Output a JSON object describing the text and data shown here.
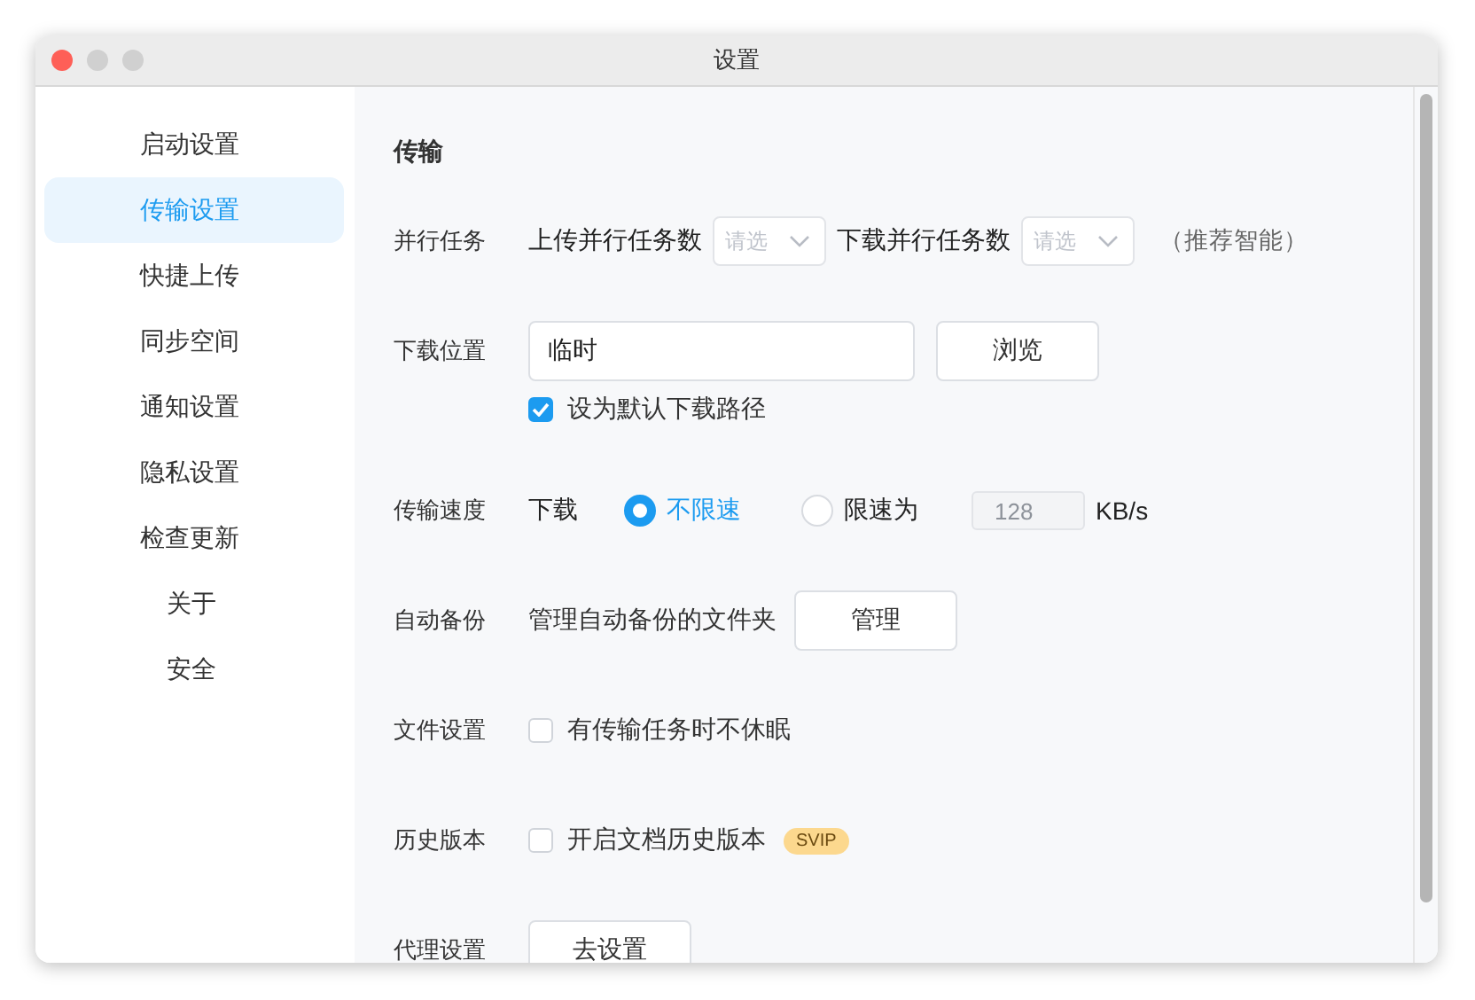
{
  "window": {
    "title": "设置"
  },
  "sidebar": {
    "items": [
      {
        "label": "启动设置",
        "selected": false
      },
      {
        "label": "传输设置",
        "selected": true
      },
      {
        "label": "快捷上传",
        "selected": false
      },
      {
        "label": "同步空间",
        "selected": false
      },
      {
        "label": "通知设置",
        "selected": false
      },
      {
        "label": "隐私设置",
        "selected": false
      },
      {
        "label": "检查更新",
        "selected": false,
        "children": [
          {
            "label": "关于",
            "selected": false
          },
          {
            "label": "安全",
            "selected": false
          }
        ]
      }
    ]
  },
  "section": {
    "title": "传输",
    "rows": [
      {
        "kind": "parallel",
        "label": "并行任务",
        "upload_label": "上传并行任务数",
        "upload_select": {
          "placeholder": "请选"
        },
        "download_label": "下载并行任务数",
        "download_select": {
          "placeholder": "请选"
        },
        "note": "（推荐智能）"
      },
      {
        "kind": "location",
        "label": "下载位置",
        "value": "临时",
        "button": "浏览",
        "checkbox": {
          "label": "设为默认下载路径",
          "checked": true
        }
      },
      {
        "kind": "speed",
        "label": "传输速度",
        "direction": "下载",
        "options": [
          {
            "label": "不限速",
            "selected": true
          },
          {
            "label": "限速为",
            "selected": false
          }
        ],
        "limit": {
          "value": "128",
          "disabled": true
        },
        "unit": "KB/s"
      },
      {
        "kind": "button",
        "label": "自动备份",
        "text": "管理自动备份的文件夹",
        "button": "管理"
      },
      {
        "kind": "checkbox",
        "label": "文件设置",
        "checkbox": {
          "label": "有传输任务时不休眠",
          "checked": false
        }
      },
      {
        "kind": "checkbox",
        "label": "历史版本",
        "checkbox": {
          "label": "开启文档历史版本",
          "checked": false
        },
        "badge": "SVIP"
      },
      {
        "kind": "button",
        "label": "代理设置",
        "button": "去设置"
      }
    ]
  }
}
